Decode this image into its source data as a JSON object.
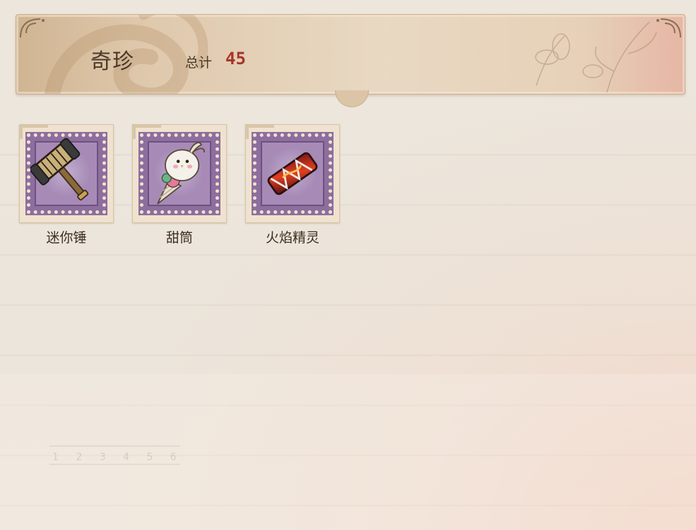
{
  "header": {
    "title": "奇珍",
    "total_label": "总计",
    "total_value": "45"
  },
  "items": [
    {
      "name": "迷你锤",
      "icon": "mini-hammer-icon"
    },
    {
      "name": "甜筒",
      "icon": "ice-cream-cone-icon"
    },
    {
      "name": "火焰精灵",
      "icon": "flame-spirit-icon"
    }
  ],
  "ruler": {
    "digits": "1 2 3 4 5 6"
  },
  "colors": {
    "accent": "#a8342c",
    "stamp": "#8d6e9e",
    "text": "#4a3829"
  }
}
